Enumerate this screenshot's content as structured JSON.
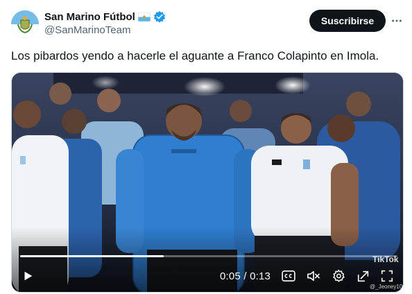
{
  "author": {
    "display_name": "San Marino Fútbol",
    "handle": "@SanMarinoTeam",
    "avatar_icon": "san-marino-crest",
    "verified_icon": "verified-badge-icon"
  },
  "follow_button": {
    "label": "Suscribirse"
  },
  "more_menu_icon": "more-dots-icon",
  "tweet": {
    "text": "Los pibardos yendo a hacerle el aguante a Franco Colapinto en Imola."
  },
  "video": {
    "current_time": "0:05",
    "duration": "0:13",
    "time_display": "0:05 / 0:13",
    "progress_fraction": 0.38,
    "watermark": "TikTok",
    "watermark_user": "@_Jeoney1030",
    "controls": {
      "play": "play-icon",
      "captions": "captions-icon",
      "mute": "muted-volume-icon",
      "settings": "gear-icon",
      "pip": "picture-in-picture-icon",
      "fullscreen": "fullscreen-icon"
    }
  },
  "colors": {
    "text": "#0f1419",
    "secondary": "#536471",
    "verified": "#1d9bf0",
    "button_bg": "#0f1419",
    "button_text": "#ffffff"
  }
}
